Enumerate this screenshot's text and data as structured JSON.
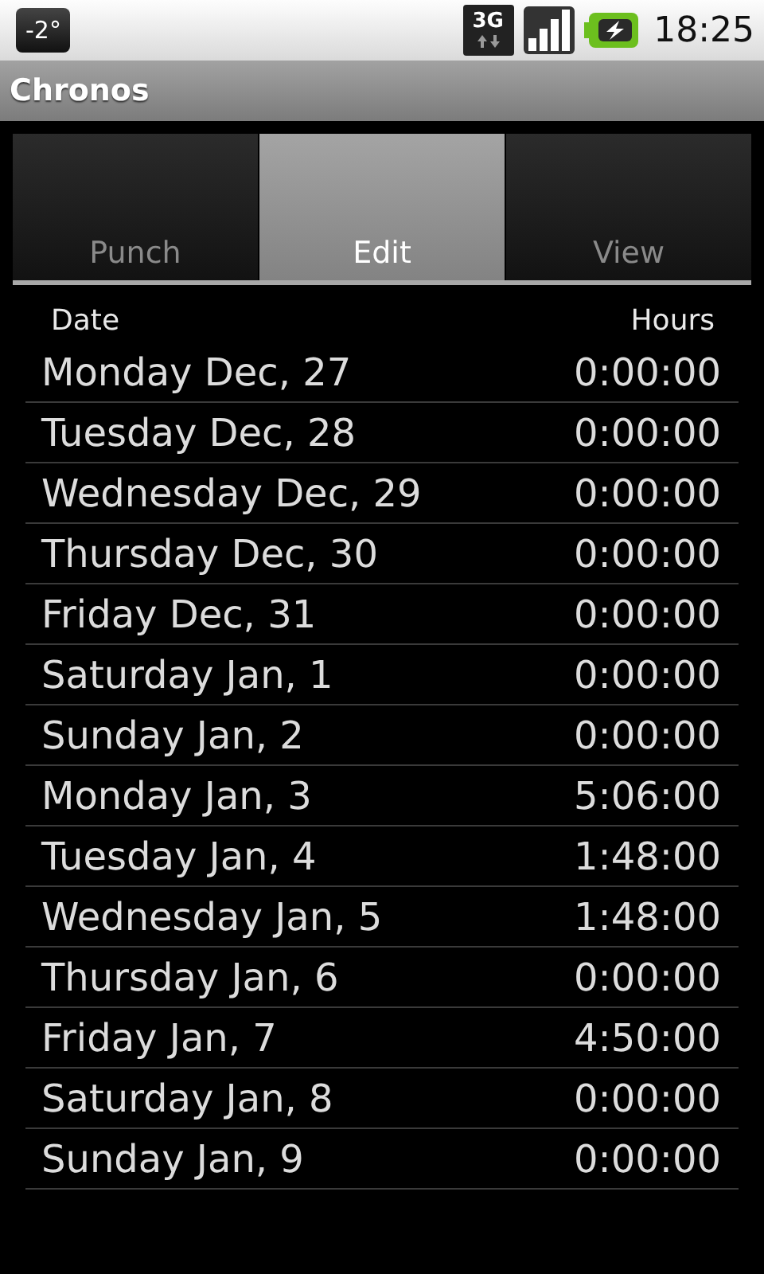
{
  "status_bar": {
    "temperature": "-2°",
    "network": "3G",
    "time": "18:25"
  },
  "title": "Chronos",
  "tabs": [
    {
      "label": "Punch",
      "selected": false
    },
    {
      "label": "Edit",
      "selected": true
    },
    {
      "label": "View",
      "selected": false
    }
  ],
  "table": {
    "columns": [
      "Date",
      "Hours"
    ],
    "rows": [
      [
        "Monday Dec, 27",
        "0:00:00"
      ],
      [
        "Tuesday Dec, 28",
        "0:00:00"
      ],
      [
        "Wednesday Dec, 29",
        "0:00:00"
      ],
      [
        "Thursday Dec, 30",
        "0:00:00"
      ],
      [
        "Friday Dec, 31",
        "0:00:00"
      ],
      [
        "Saturday Jan, 1",
        "0:00:00"
      ],
      [
        "Sunday Jan, 2",
        "0:00:00"
      ],
      [
        "Monday Jan, 3",
        "5:06:00"
      ],
      [
        "Tuesday Jan, 4",
        "1:48:00"
      ],
      [
        "Wednesday Jan, 5",
        "1:48:00"
      ],
      [
        "Thursday Jan, 6",
        "0:00:00"
      ],
      [
        "Friday Jan, 7",
        "4:50:00"
      ],
      [
        "Saturday Jan, 8",
        "0:00:00"
      ],
      [
        "Sunday Jan, 9",
        "0:00:00"
      ]
    ]
  }
}
